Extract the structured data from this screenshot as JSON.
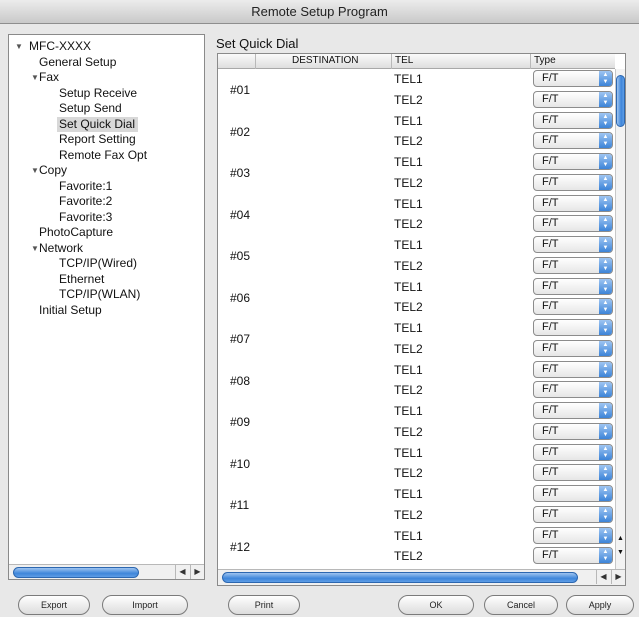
{
  "window": {
    "title": "Remote Setup Program"
  },
  "tree": {
    "items": [
      {
        "label": "MFC-XXXX",
        "level": 0,
        "expanded": true
      },
      {
        "label": "General Setup",
        "level": 1
      },
      {
        "label": "Fax",
        "level": 1,
        "expanded": true
      },
      {
        "label": "Setup Receive",
        "level": 2
      },
      {
        "label": "Setup Send",
        "level": 2
      },
      {
        "label": "Set Quick Dial",
        "level": 2,
        "selected": true
      },
      {
        "label": "Report Setting",
        "level": 2
      },
      {
        "label": "Remote Fax Opt",
        "level": 2
      },
      {
        "label": "Copy",
        "level": 1,
        "expanded": true
      },
      {
        "label": "Favorite:1",
        "level": 2
      },
      {
        "label": "Favorite:2",
        "level": 2
      },
      {
        "label": "Favorite:3",
        "level": 2
      },
      {
        "label": "PhotoCapture",
        "level": 1
      },
      {
        "label": "Network",
        "level": 1,
        "expanded": true
      },
      {
        "label": "TCP/IP(Wired)",
        "level": 2
      },
      {
        "label": "Ethernet",
        "level": 2
      },
      {
        "label": "TCP/IP(WLAN)",
        "level": 2
      },
      {
        "label": "Initial Setup",
        "level": 1
      }
    ]
  },
  "main": {
    "section_title": "Set Quick Dial",
    "columns": [
      "DESTINATION",
      "TEL",
      "Type"
    ],
    "entries": [
      {
        "num": "#01",
        "tels": [
          "TEL1",
          "TEL2"
        ],
        "types": [
          "F/T",
          "F/T"
        ]
      },
      {
        "num": "#02",
        "tels": [
          "TEL1",
          "TEL2"
        ],
        "types": [
          "F/T",
          "F/T"
        ]
      },
      {
        "num": "#03",
        "tels": [
          "TEL1",
          "TEL2"
        ],
        "types": [
          "F/T",
          "F/T"
        ]
      },
      {
        "num": "#04",
        "tels": [
          "TEL1",
          "TEL2"
        ],
        "types": [
          "F/T",
          "F/T"
        ]
      },
      {
        "num": "#05",
        "tels": [
          "TEL1",
          "TEL2"
        ],
        "types": [
          "F/T",
          "F/T"
        ]
      },
      {
        "num": "#06",
        "tels": [
          "TEL1",
          "TEL2"
        ],
        "types": [
          "F/T",
          "F/T"
        ]
      },
      {
        "num": "#07",
        "tels": [
          "TEL1",
          "TEL2"
        ],
        "types": [
          "F/T",
          "F/T"
        ]
      },
      {
        "num": "#08",
        "tels": [
          "TEL1",
          "TEL2"
        ],
        "types": [
          "F/T",
          "F/T"
        ]
      },
      {
        "num": "#09",
        "tels": [
          "TEL1",
          "TEL2"
        ],
        "types": [
          "F/T",
          "F/T"
        ]
      },
      {
        "num": "#10",
        "tels": [
          "TEL1",
          "TEL2"
        ],
        "types": [
          "F/T",
          "F/T"
        ]
      },
      {
        "num": "#11",
        "tels": [
          "TEL1",
          "TEL2"
        ],
        "types": [
          "F/T",
          "F/T"
        ]
      },
      {
        "num": "#12",
        "tels": [
          "TEL1",
          "TEL2"
        ],
        "types": [
          "F/T",
          "F/T"
        ]
      }
    ]
  },
  "buttons": {
    "export": "Export",
    "import": "Import",
    "print": "Print",
    "ok": "OK",
    "cancel": "Cancel",
    "apply": "Apply"
  },
  "icons": {
    "expand": "disclosure-triangle-icon",
    "stepper": "up-down-stepper-icon",
    "scroll_left": "scroll-left-arrow-icon",
    "scroll_right": "scroll-right-arrow-icon"
  }
}
